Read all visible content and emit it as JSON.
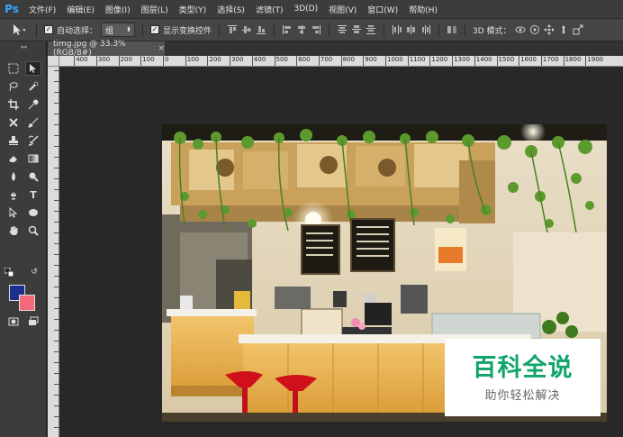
{
  "app": {
    "logo": "Ps"
  },
  "menu": {
    "items": [
      "文件(F)",
      "编辑(E)",
      "图像(I)",
      "图层(L)",
      "类型(Y)",
      "选择(S)",
      "滤镜(T)",
      "3D(D)",
      "视图(V)",
      "窗口(W)",
      "帮助(H)"
    ]
  },
  "options": {
    "auto_select_label": "自动选择：",
    "auto_select_value": "组",
    "show_transform_label": "显示变换控件",
    "mode_3d_label": "3D 模式："
  },
  "document": {
    "tab_title": "timg.jpg @ 33.3%(RGB/8#)",
    "close": "×"
  },
  "ruler": {
    "h_labels": [
      "0",
      "100",
      "200",
      "300",
      "400",
      "500",
      "600",
      "700",
      "800",
      "900",
      "1000",
      "1100",
      "1200",
      "1300",
      "1400",
      "1500",
      "1600",
      "1700",
      "1800",
      "1900"
    ],
    "h_prefix": [
      "400",
      "300",
      "200",
      "100"
    ]
  },
  "watermark": {
    "title": "百科全说",
    "subtitle": "助你轻松解决"
  },
  "colors": {
    "foreground": "#1a2f8f",
    "background": "#f56a7a",
    "watermark_green": "#11a56a"
  }
}
